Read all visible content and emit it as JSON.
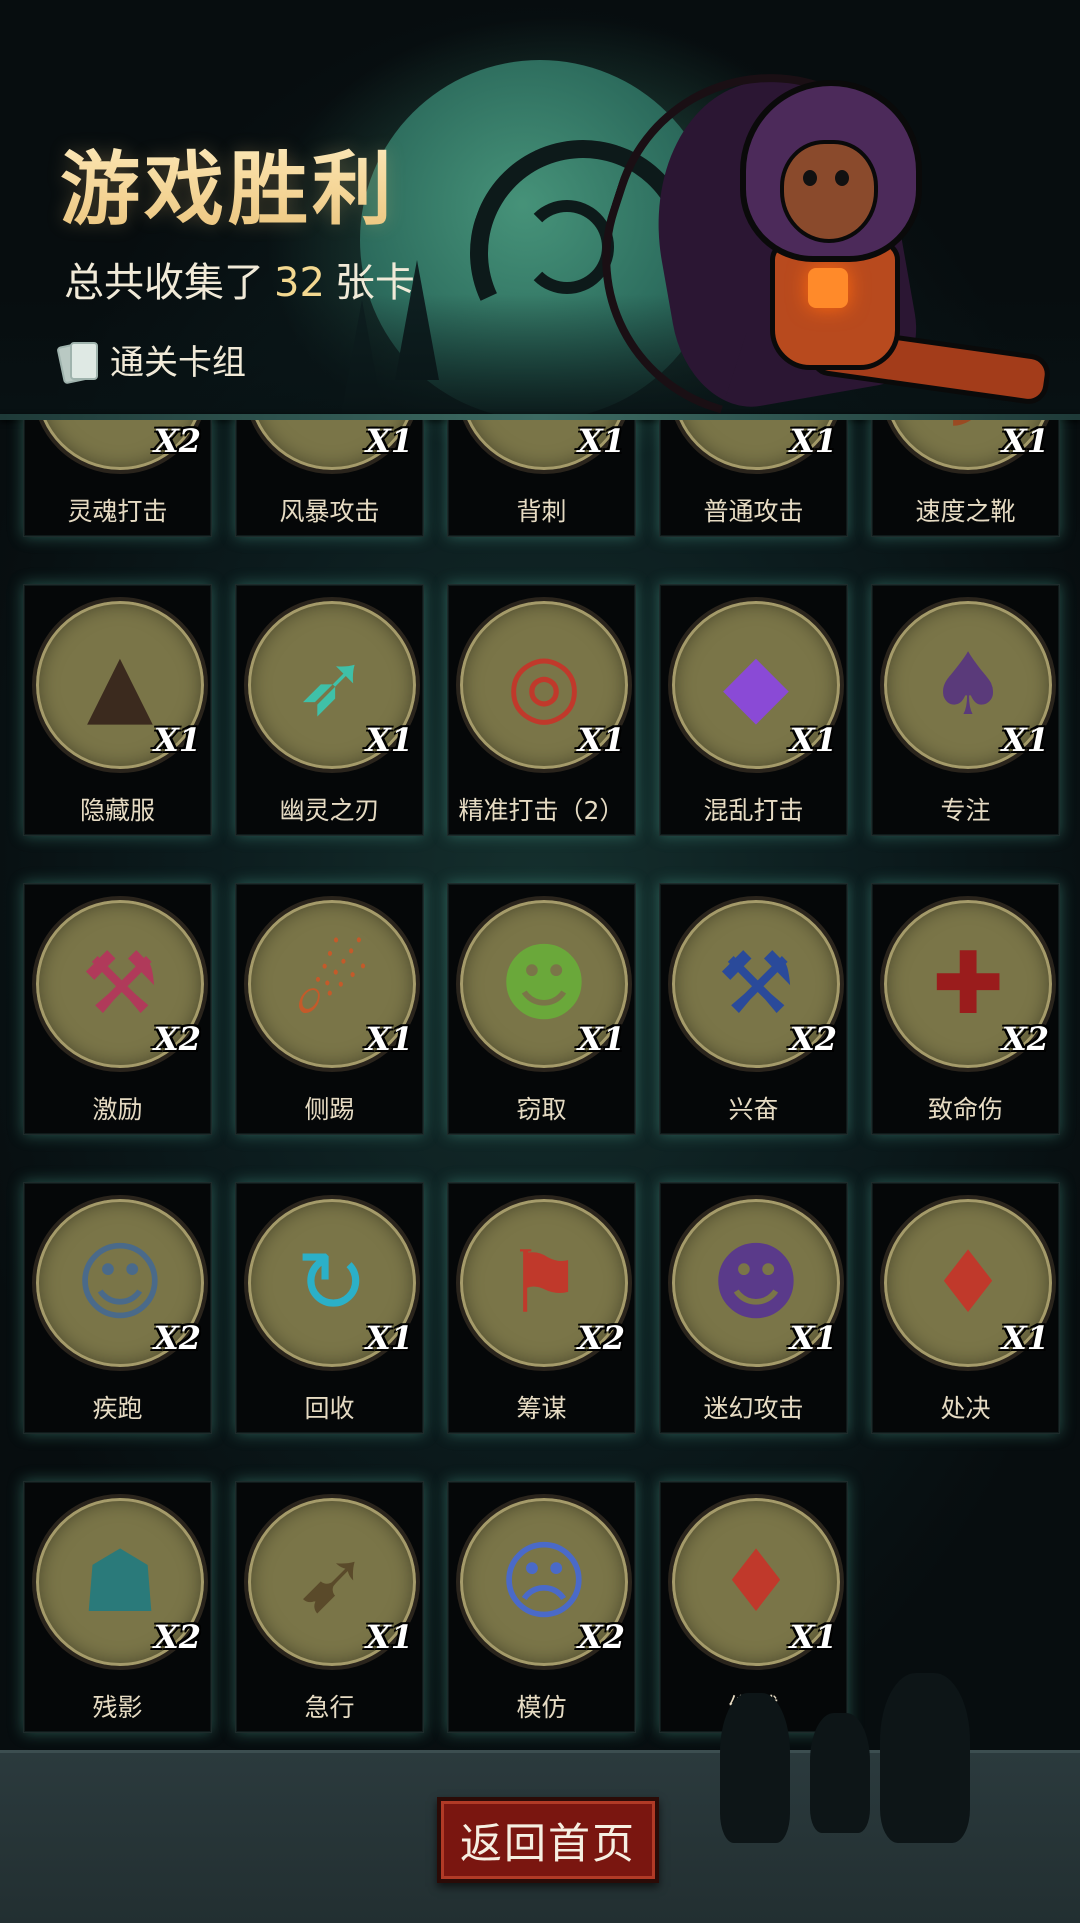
{
  "header": {
    "title": "游戏胜利",
    "summary_prefix": "总共收集了",
    "total_cards": "32",
    "summary_suffix": "张卡",
    "deck_label": "通关卡组"
  },
  "cards": [
    {
      "name": "灵魂打击",
      "qty": "X2",
      "icon": "ice-shatter-icon",
      "glyph": "❄",
      "color": "#9fd6ff"
    },
    {
      "name": "风暴攻击",
      "qty": "X1",
      "icon": "storm-burst-icon",
      "glyph": "✷",
      "color": "#c9d8ff"
    },
    {
      "name": "背刺",
      "qty": "X1",
      "icon": "backstab-icon",
      "glyph": "✦",
      "color": "#b9c98a"
    },
    {
      "name": "普通攻击",
      "qty": "X1",
      "icon": "basic-attack-icon",
      "glyph": "⚔",
      "color": "#5fd0b0"
    },
    {
      "name": "速度之靴",
      "qty": "X1",
      "icon": "boots-icon",
      "glyph": "◗",
      "color": "#9a4a22"
    },
    {
      "name": "隐藏服",
      "qty": "X1",
      "icon": "hood-icon",
      "glyph": "▲",
      "color": "#3b2a1e"
    },
    {
      "name": "幽灵之刃",
      "qty": "X1",
      "icon": "ghost-blade-icon",
      "glyph": "➶",
      "color": "#3fc0a8"
    },
    {
      "name": "精准打击（2）",
      "qty": "X1",
      "icon": "target-icon",
      "glyph": "◎",
      "color": "#c0392b"
    },
    {
      "name": "混乱打击",
      "qty": "X1",
      "icon": "chaos-strike-icon",
      "glyph": "◆",
      "color": "#8a4ad6"
    },
    {
      "name": "专注",
      "qty": "X1",
      "icon": "wizard-icon",
      "glyph": "♠",
      "color": "#5a3a7a"
    },
    {
      "name": "激励",
      "qty": "X2",
      "icon": "hammer-brute-icon",
      "glyph": "⚒",
      "color": "#b03a5a"
    },
    {
      "name": "侧踢",
      "qty": "X1",
      "icon": "kick-icon",
      "glyph": "☄",
      "color": "#c45a2a"
    },
    {
      "name": "窃取",
      "qty": "X1",
      "icon": "goblin-thief-icon",
      "glyph": "☻",
      "color": "#6aa83a"
    },
    {
      "name": "兴奋",
      "qty": "X2",
      "icon": "excited-dwarf-icon",
      "glyph": "⚒",
      "color": "#2a4a9a"
    },
    {
      "name": "致命伤",
      "qty": "X2",
      "icon": "bleeding-dagger-icon",
      "glyph": "✚",
      "color": "#9a1c1c"
    },
    {
      "name": "疾跑",
      "qty": "X2",
      "icon": "sprinting-beast-icon",
      "glyph": "☺",
      "color": "#4a6a8a"
    },
    {
      "name": "回收",
      "qty": "X1",
      "icon": "whirl-recycle-icon",
      "glyph": "↻",
      "color": "#2bb0c8"
    },
    {
      "name": "筹谋",
      "qty": "X2",
      "icon": "map-plan-icon",
      "glyph": "⚑",
      "color": "#c0392b"
    },
    {
      "name": "迷幻攻击",
      "qty": "X1",
      "icon": "illusion-witch-icon",
      "glyph": "☻",
      "color": "#5a3a8a"
    },
    {
      "name": "处决",
      "qty": "X1",
      "icon": "execution-icon",
      "glyph": "♦",
      "color": "#c0392b"
    },
    {
      "name": "残影",
      "qty": "X2",
      "icon": "afterimage-icon",
      "glyph": "☗",
      "color": "#2a7a7a"
    },
    {
      "name": "急行",
      "qty": "X1",
      "icon": "rush-warrior-icon",
      "glyph": "➹",
      "color": "#5a4a2a"
    },
    {
      "name": "模仿",
      "qty": "X2",
      "icon": "mimic-goblin-icon",
      "glyph": "☹",
      "color": "#4a6ac8"
    },
    {
      "name": "缴械",
      "qty": "X1",
      "icon": "disarm-icon",
      "glyph": "♦",
      "color": "#c0392b"
    }
  ],
  "footer": {
    "home_button": "返回首页"
  }
}
